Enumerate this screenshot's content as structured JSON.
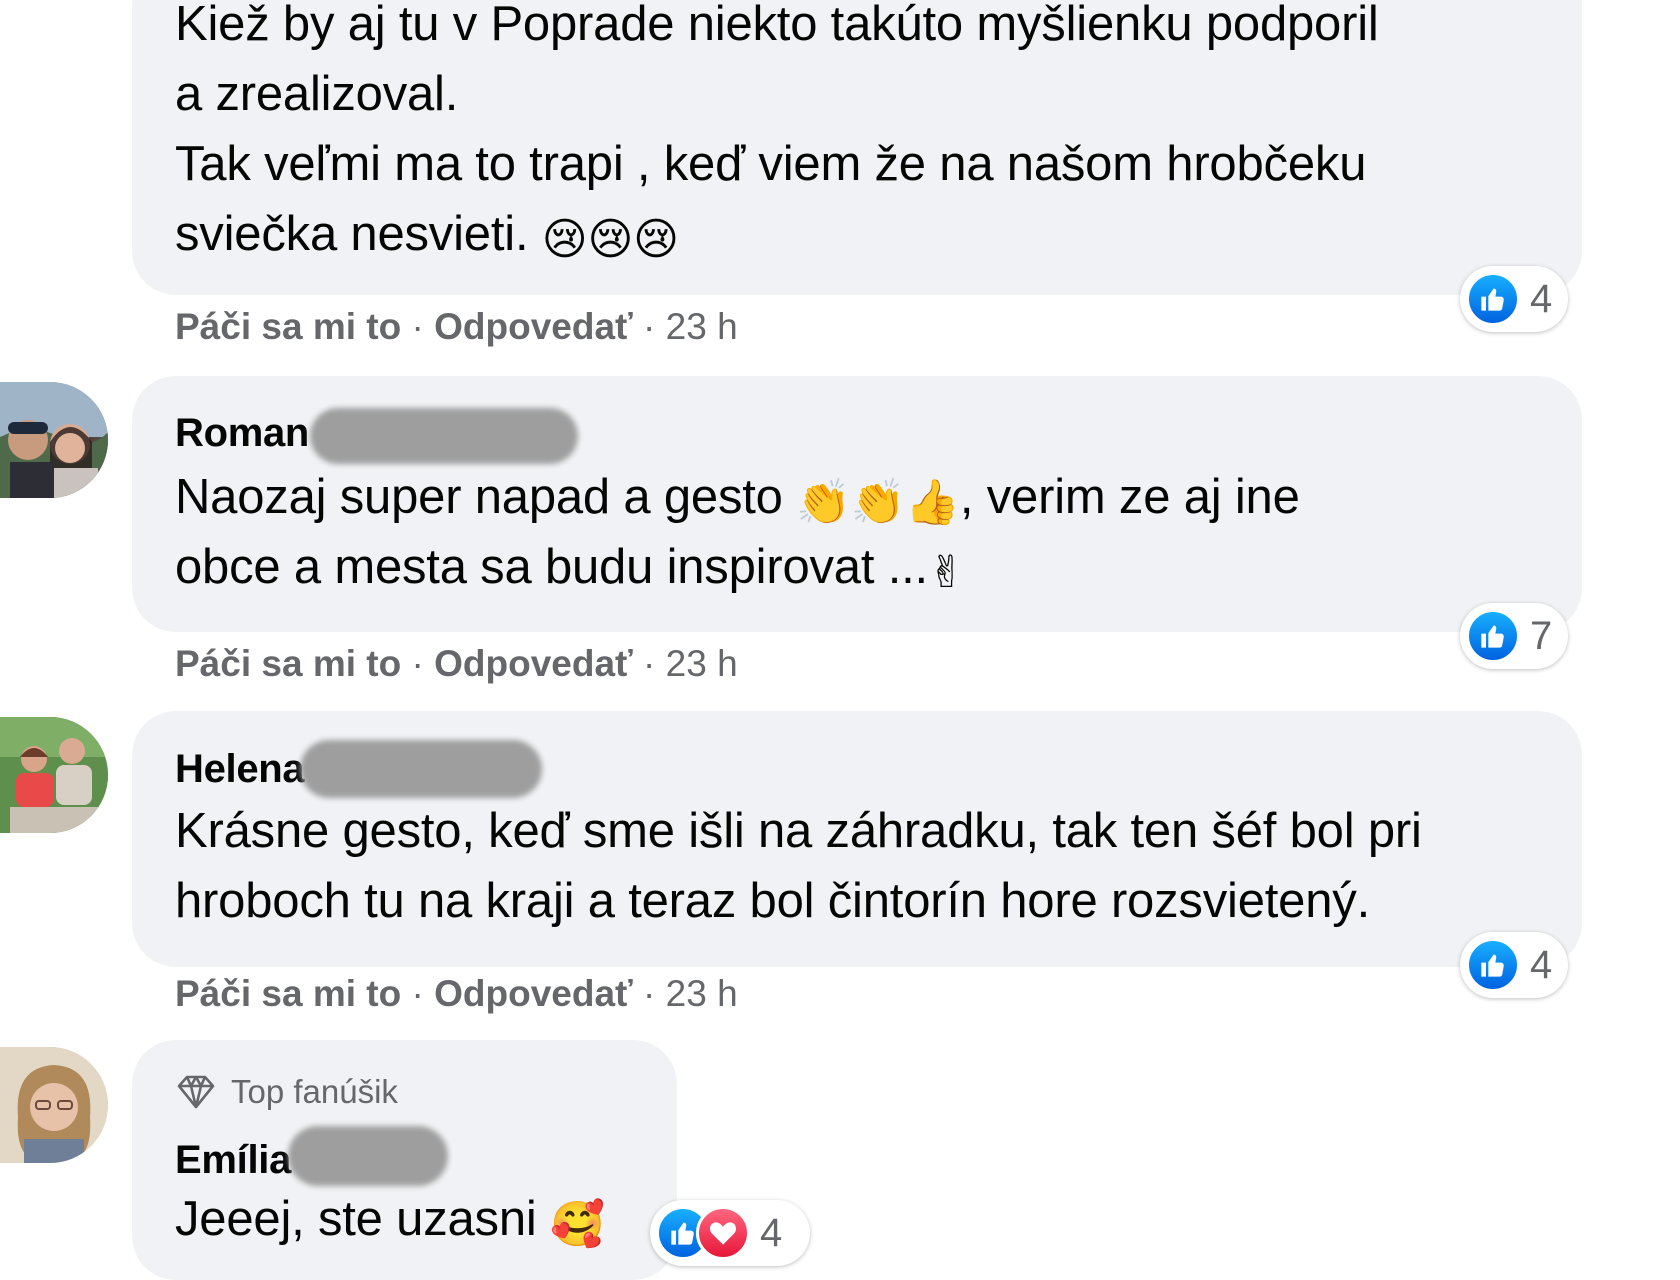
{
  "comments": [
    {
      "text_lines": [
        "Kiež by aj tu v Poprade niekto takúto myšlienku podporil",
        "a zrealizoval.",
        "Tak veľmi ma to trapi , keď viem že na našom hrobčeku",
        "sviečka nesvieti."
      ],
      "emojis": "😢😢😢",
      "reaction_count": "4",
      "actions": {
        "like": "Páči sa mi to",
        "reply": "Odpovedať",
        "time": "23 h"
      }
    },
    {
      "author": "Roman",
      "line1_before": "Naozaj super napad a gesto ",
      "line1_emojis": "👏👏👍",
      "line1_after": ", verim ze aj ine",
      "line2": "obce a mesta sa budu inspirovat ...",
      "line2_emoji": "✌",
      "reaction_count": "7",
      "actions": {
        "like": "Páči sa mi to",
        "reply": "Odpovedať",
        "time": "23 h"
      }
    },
    {
      "author": "Helena",
      "text_lines": [
        "Krásne gesto, keď sme išli na záhradku, tak ten šéf bol pri",
        "hroboch tu na kraji a teraz bol čintorín hore rozsvietený."
      ],
      "reaction_count": "4",
      "actions": {
        "like": "Páči sa mi to",
        "reply": "Odpovedať",
        "time": "23 h"
      }
    },
    {
      "badge": "Top fanúšik",
      "author": "Emília",
      "text": "Jeeej, ste uzasni ",
      "emoji": "🥰",
      "reaction_count": "4"
    }
  ],
  "separator": " · ",
  "colors": {
    "bubble": "#f0f2f5",
    "meta": "#65676b",
    "like": "#1877f2",
    "love": "#f33e58"
  },
  "icons": [
    "like-reaction-icon",
    "love-reaction-icon",
    "diamond-icon"
  ]
}
